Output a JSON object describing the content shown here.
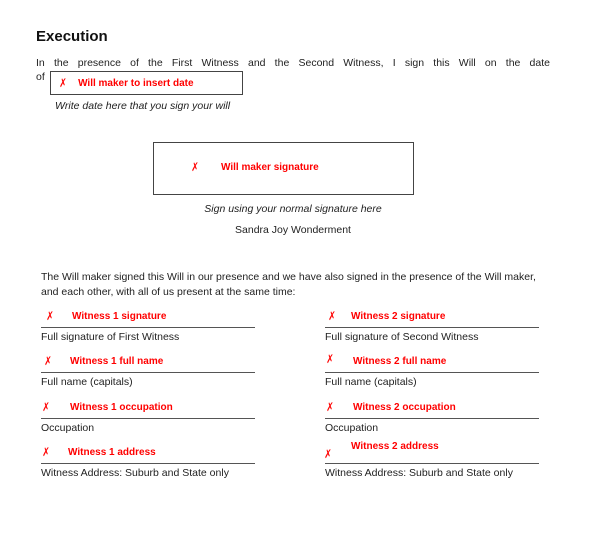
{
  "heading": "Execution",
  "intro_text": "In the presence of the First Witness and the Second Witness, I sign this Will on the date",
  "intro_of": "of",
  "date_field": {
    "icon": "x-mark-icon",
    "mark": "✗",
    "placeholder": "Will maker to insert date",
    "hint": "Write date here that you sign your will"
  },
  "signature_field": {
    "mark": "✗",
    "placeholder": "Will maker signature",
    "hint": "Sign using your normal signature here",
    "signer_name": "Sandra Joy Wonderment"
  },
  "witness_statement": "The Will maker signed this Will in our presence and we have also signed in the presence of the Will maker, and each other, with all of us present at the same time:",
  "colors": {
    "placeholder_red": "#ff0000",
    "text": "#222222",
    "rule": "#555555"
  },
  "witnesses": [
    {
      "fields": [
        {
          "mark": "✗",
          "placeholder": "Witness 1 signature",
          "label": "Full signature of First Witness"
        },
        {
          "mark": "✗",
          "placeholder": "Witness 1 full name",
          "label": "Full name (capitals)"
        },
        {
          "mark": "✗",
          "placeholder": "Witness 1 occupation",
          "label": "Occupation"
        },
        {
          "mark": "✗",
          "placeholder": "Witness 1 address",
          "label": "Witness Address:  Suburb and State only"
        }
      ]
    },
    {
      "fields": [
        {
          "mark": "✗",
          "placeholder": "Witness 2 signature",
          "label": "Full signature of Second Witness"
        },
        {
          "mark": "✗",
          "placeholder": "Witness 2 full name",
          "label": "Full name (capitals)"
        },
        {
          "mark": "✗",
          "placeholder": "Witness 2 occupation",
          "label": "Occupation"
        },
        {
          "mark": "✗",
          "placeholder": "Witness 2 address",
          "label": "Witness Address:  Suburb and State only"
        }
      ]
    }
  ]
}
